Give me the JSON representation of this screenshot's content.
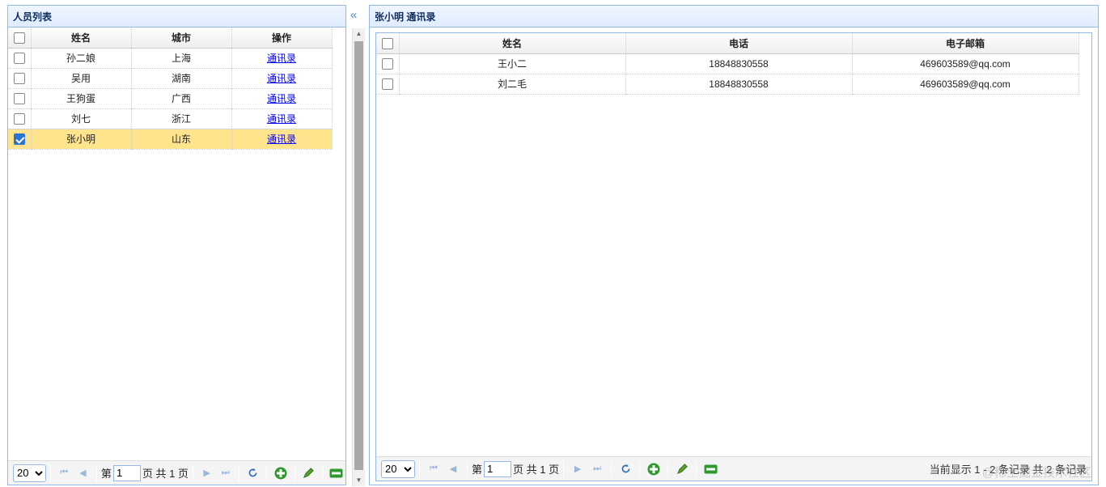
{
  "left_panel": {
    "title": "人员列表",
    "collapse_icon": "double-chevron-left-icon",
    "columns": [
      "姓名",
      "城市",
      "操作"
    ],
    "rows": [
      {
        "name": "孙二娘",
        "city": "上海",
        "action": "通讯录",
        "checked": false
      },
      {
        "name": "吴用",
        "city": "湖南",
        "action": "通讯录",
        "checked": false
      },
      {
        "name": "王狗蛋",
        "city": "广西",
        "action": "通讯录",
        "checked": false
      },
      {
        "name": "刘七",
        "city": "浙江",
        "action": "通讯录",
        "checked": false
      },
      {
        "name": "张小明",
        "city": "山东",
        "action": "通讯录",
        "checked": true
      }
    ],
    "pager": {
      "page_size": "20",
      "page_prefix": "第",
      "page_value": "1",
      "page_suffix": "页 共 1 页"
    }
  },
  "right_panel": {
    "title": "张小明 通讯录",
    "columns": [
      "姓名",
      "电话",
      "电子邮箱"
    ],
    "rows": [
      {
        "name": "王小二",
        "phone": "18848830558",
        "email": "469603589@qq.com"
      },
      {
        "name": "刘二毛",
        "phone": "18848830558",
        "email": "469603589@qq.com"
      }
    ],
    "pager": {
      "page_size": "20",
      "page_prefix": "第",
      "page_value": "1",
      "page_suffix": "页 共 1 页",
      "info": "当前显示 1 - 2 条记录 共 2 条记录"
    }
  },
  "watermark": "@稀土掘金技术社区",
  "colors": {
    "selected_row": "#ffe48d",
    "panel_border": "#95b8e7",
    "header_text": "#0e2d5f",
    "add_icon": "#2e9a2e"
  }
}
